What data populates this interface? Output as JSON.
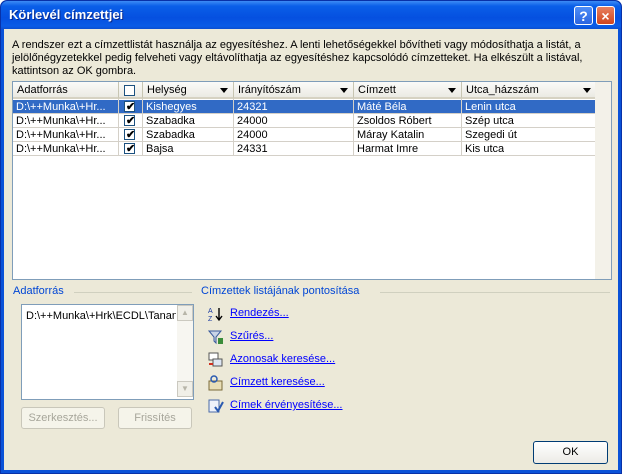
{
  "window": {
    "title": "Körlevél címzettjei",
    "help_label": "?",
    "close_label": "×"
  },
  "intro": "A rendszer ezt a címzettlistát használja az egyesítéshez. A lenti lehetőségekkel bővítheti vagy módosíthatja a listát, a jelölőnégyzetekkel pedig felveheti vagy eltávolíthatja az egyesítéshez kapcsolódó címzetteket. Ha elkészült a listával, kattintson az OK gombra.",
  "table": {
    "columns": [
      "Adatforrás",
      "",
      "Helység",
      "Irányítószám",
      "Címzett",
      "Utca_házszám"
    ],
    "rows": [
      {
        "source": "D:\\++Munka\\+Hr...",
        "checked": true,
        "city": "Kishegyes",
        "zip": "24321",
        "name": "Máté Béla",
        "street": "Lenin utca"
      },
      {
        "source": "D:\\++Munka\\+Hr...",
        "checked": true,
        "city": "Szabadka",
        "zip": "24000",
        "name": "Zsoldos Róbert",
        "street": "Szép utca"
      },
      {
        "source": "D:\\++Munka\\+Hr...",
        "checked": true,
        "city": "Szabadka",
        "zip": "24000",
        "name": "Máray Katalin",
        "street": "Szegedi út"
      },
      {
        "source": "D:\\++Munka\\+Hr...",
        "checked": true,
        "city": "Bajsa",
        "zip": "24331",
        "name": "Harmat Imre",
        "street": "Kis utca"
      }
    ]
  },
  "datasource": {
    "label": "Adatforrás",
    "item": "D:\\++Munka\\+Hrk\\ECDL\\Tanan",
    "edit_label": "Szerkesztés...",
    "refresh_label": "Frissítés"
  },
  "refine": {
    "label": "Címzettek listájának pontosítása",
    "links": [
      "Rendezés...",
      "Szűrés...",
      "Azonosak keresése...",
      "Címzett keresése...",
      "Címek érvényesítése..."
    ]
  },
  "ok_label": "OK",
  "colors": {
    "title_blue": "#0a5fe8",
    "selection": "#316ac5",
    "link": "#0000ff",
    "group_label": "#0046d5"
  }
}
